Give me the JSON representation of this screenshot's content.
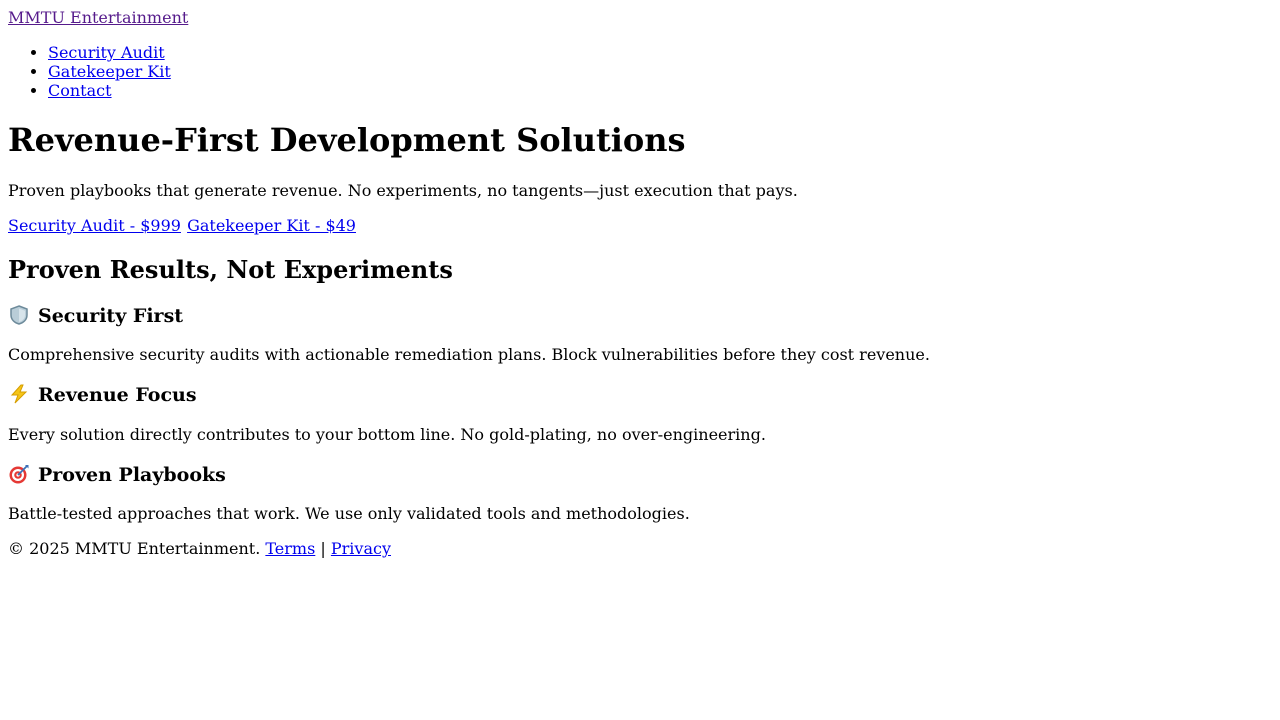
{
  "header": {
    "brand": "MMTU Entertainment",
    "nav": [
      {
        "label": "Security Audit"
      },
      {
        "label": "Gatekeeper Kit"
      },
      {
        "label": "Contact"
      }
    ]
  },
  "hero": {
    "title": "Revenue-First Development Solutions",
    "subtitle": "Proven playbooks that generate revenue. No experiments, no tangents—just execution that pays.",
    "cta_security": "Security Audit - $999",
    "cta_gatekeeper": "Gatekeeper Kit - $49"
  },
  "features": {
    "heading": "Proven Results, Not Experiments",
    "items": [
      {
        "icon": "shield-icon",
        "title": "Security First",
        "text": "Comprehensive security audits with actionable remediation plans. Block vulnerabilities before they cost revenue."
      },
      {
        "icon": "lightning-icon",
        "title": "Revenue Focus",
        "text": "Every solution directly contributes to your bottom line. No gold-plating, no over-engineering."
      },
      {
        "icon": "target-icon",
        "title": "Proven Playbooks",
        "text": "Battle-tested approaches that work. We use only validated tools and methodologies."
      }
    ]
  },
  "footer": {
    "copyright": "© 2025 MMTU Entertainment.",
    "terms": "Terms",
    "separator": "|",
    "privacy": "Privacy"
  },
  "colors": {
    "link": "#0000ee",
    "visited_link": "#551a8b",
    "text": "#000000",
    "background": "#ffffff"
  }
}
